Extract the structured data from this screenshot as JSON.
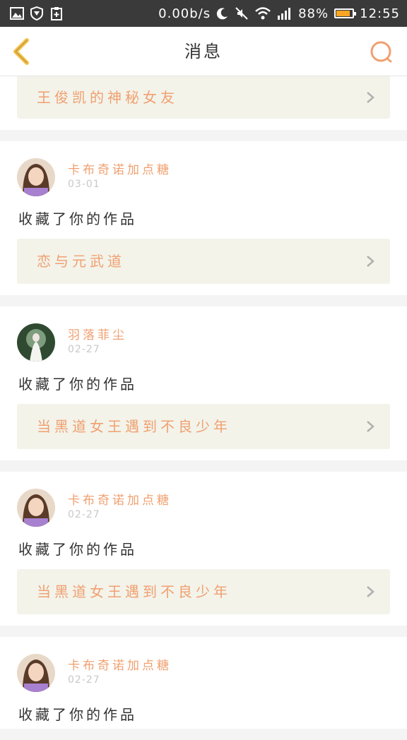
{
  "status_bar": {
    "net_speed": "0.00b/s",
    "battery_percent": "88%",
    "battery_level": 0.88,
    "time": "12:55"
  },
  "nav": {
    "title": "消息",
    "accent_color": "#f6c24a",
    "search_color": "#f0a070"
  },
  "top_item": {
    "work_title": "王俊凯的神秘女友"
  },
  "messages": [
    {
      "username": "卡布奇诺加点糖",
      "date": "03-01",
      "action": "收藏了你的作品",
      "work_title": "恋与元武道"
    },
    {
      "username": "羽落菲尘",
      "date": "02-27",
      "action": "收藏了你的作品",
      "work_title": "当黑道女王遇到不良少年"
    },
    {
      "username": "卡布奇诺加点糖",
      "date": "02-27",
      "action": "收藏了你的作品",
      "work_title": "当黑道女王遇到不良少年"
    },
    {
      "username": "卡布奇诺加点糖",
      "date": "02-27",
      "action": "收藏了你的作品"
    }
  ]
}
